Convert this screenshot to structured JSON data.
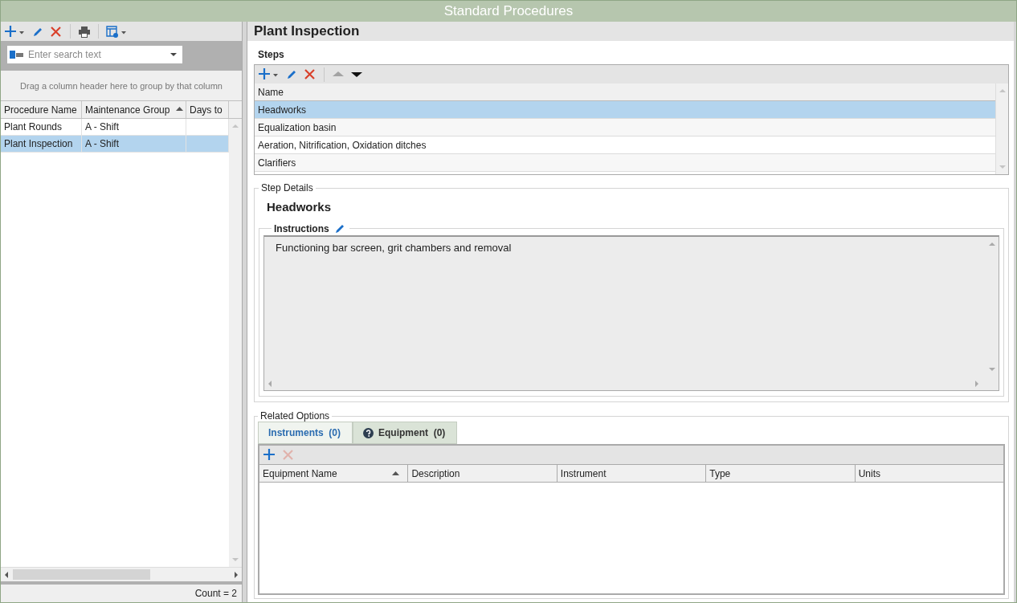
{
  "window": {
    "title": "Standard Procedures"
  },
  "left": {
    "toolbar": [
      {
        "kind": "add_menu",
        "disabled": false
      },
      {
        "kind": "edit",
        "disabled": false
      },
      {
        "kind": "delete",
        "disabled": false
      },
      {
        "kind": "separator"
      },
      {
        "kind": "print",
        "disabled": false
      },
      {
        "kind": "separator"
      },
      {
        "kind": "layout_menu",
        "disabled": false
      }
    ],
    "search": {
      "placeholder": "Enter search text"
    },
    "group_hint": "Drag a column header here to group by that column",
    "columns": [
      {
        "label": "Procedure Name",
        "sorted": false
      },
      {
        "label": "Maintenance Group",
        "sorted": true
      },
      {
        "label": "Days to",
        "sorted": false
      }
    ],
    "rows": [
      {
        "cells": [
          "Plant Rounds",
          "A - Shift",
          ""
        ],
        "selected": false
      },
      {
        "cells": [
          "Plant Inspection",
          "A - Shift",
          ""
        ],
        "selected": true
      }
    ],
    "status": "Count = 2"
  },
  "right": {
    "title": "Plant Inspection",
    "steps": {
      "label": "Steps",
      "toolbar": [
        {
          "kind": "add_menu",
          "disabled": false
        },
        {
          "kind": "edit",
          "disabled": false
        },
        {
          "kind": "delete",
          "disabled": false
        },
        {
          "kind": "separator"
        },
        {
          "kind": "up",
          "disabled": true
        },
        {
          "kind": "down",
          "disabled": false
        }
      ],
      "column": "Name",
      "rows": [
        {
          "name": "Headworks",
          "selected": true
        },
        {
          "name": "Equalization basin",
          "selected": false
        },
        {
          "name": "Aeration, Nitrification, Oxidation ditches",
          "selected": false
        },
        {
          "name": "Clarifiers",
          "selected": false
        }
      ]
    },
    "details": {
      "label": "Step Details",
      "step_name": "Headworks",
      "instructions_label": "Instructions",
      "instructions": "Functioning bar screen, grit chambers and removal"
    },
    "related": {
      "label": "Related Options",
      "tabs": [
        {
          "label": "Instruments  (0)",
          "selected": true,
          "help_icon": false
        },
        {
          "label": "Equipment  (0)",
          "selected": false,
          "help_icon": true
        }
      ],
      "toolbar": [
        {
          "kind": "add",
          "disabled": false
        },
        {
          "kind": "delete",
          "disabled": true
        }
      ],
      "columns": [
        {
          "label": "Equipment Name",
          "sorted": true
        },
        {
          "label": "Description",
          "sorted": false
        },
        {
          "label": "Instrument",
          "sorted": false
        },
        {
          "label": "Type",
          "sorted": false
        },
        {
          "label": "Units",
          "sorted": false
        }
      ]
    }
  }
}
